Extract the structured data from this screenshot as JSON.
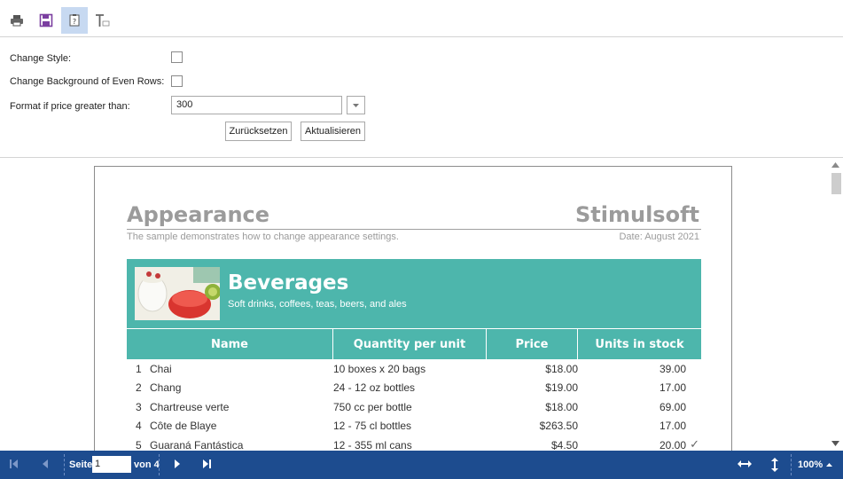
{
  "toolbar": {
    "print_icon": "print-icon",
    "save_icon": "save-icon",
    "parameters_icon": "parameters-icon",
    "editor_icon": "text-editor-icon"
  },
  "params": {
    "change_style_label": "Change Style:",
    "change_bg_label": "Change Background of Even Rows:",
    "format_price_label": "Format if price greater than:",
    "price_value": "300",
    "reset_label": "Zurücksetzen",
    "update_label": "Aktualisieren"
  },
  "report": {
    "title": "Appearance",
    "brand": "Stimulsoft",
    "subtitle": "The sample demonstrates how to change appearance settings.",
    "date": "Date: August 2021",
    "category": {
      "name": "Beverages",
      "description": "Soft drinks, coffees, teas, beers, and ales"
    },
    "columns": [
      "Name",
      "Quantity per unit",
      "Price",
      "Units in stock"
    ],
    "rows": [
      {
        "n": "1",
        "name": "Chai",
        "qty": "10 boxes x 20 bags",
        "price": "$18.00",
        "stock": "39.00",
        "check": ""
      },
      {
        "n": "2",
        "name": "Chang",
        "qty": "24 - 12 oz bottles",
        "price": "$19.00",
        "stock": "17.00",
        "check": ""
      },
      {
        "n": "3",
        "name": "Chartreuse verte",
        "qty": "750 cc per bottle",
        "price": "$18.00",
        "stock": "69.00",
        "check": ""
      },
      {
        "n": "4",
        "name": "Côte de Blaye",
        "qty": "12 - 75 cl bottles",
        "price": "$263.50",
        "stock": "17.00",
        "check": ""
      },
      {
        "n": "5",
        "name": "Guaraná Fantástica",
        "qty": "12 - 355 ml cans",
        "price": "$4.50",
        "stock": "20.00",
        "check": "✓"
      }
    ]
  },
  "statusbar": {
    "page_label": "Seite",
    "page_value": "1",
    "of_label": "von 4",
    "zoom": "100%"
  },
  "colors": {
    "accent_teal": "#4db6ac",
    "status_blue": "#1d4c8f"
  }
}
